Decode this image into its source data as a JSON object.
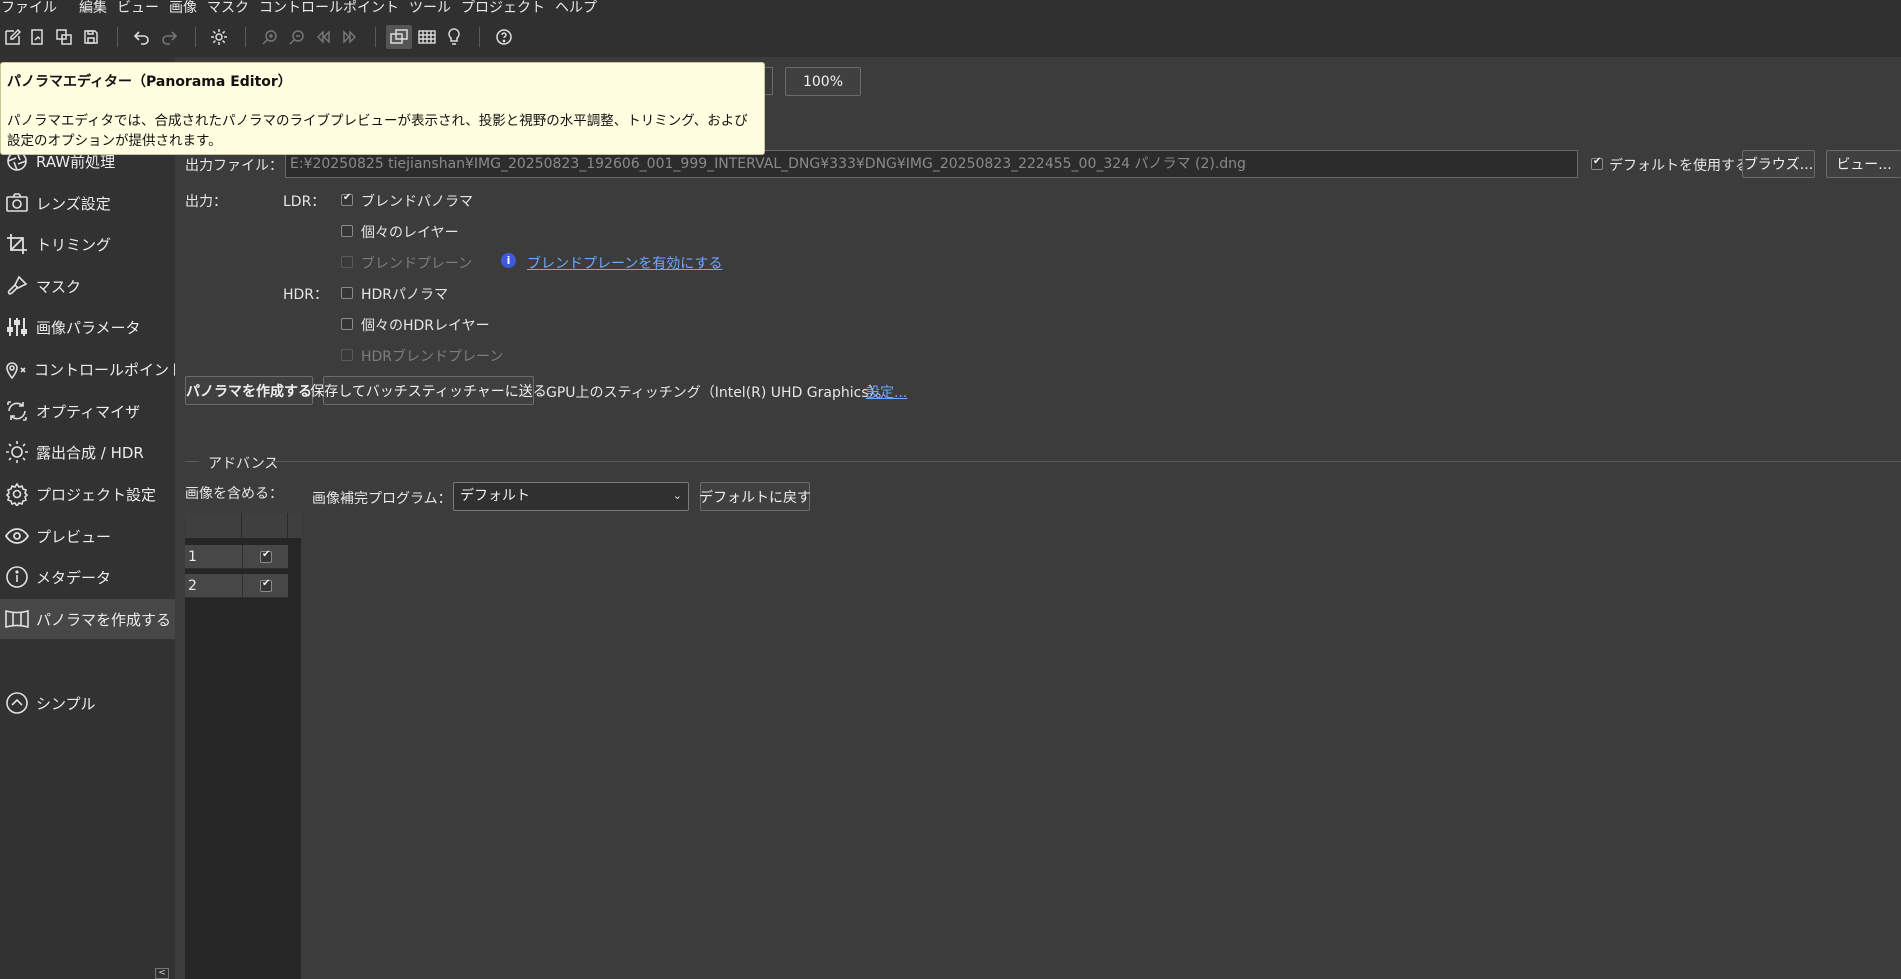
{
  "menu": [
    "ファイル",
    "編集",
    "ビュー",
    "画像",
    "マスク",
    "コントロールポイント",
    "ツール",
    "プロジェクト",
    "ヘルプ"
  ],
  "toolbar": {
    "icons": [
      "new-project-icon",
      "open-icon",
      "copy-icon",
      "save-icon",
      "undo-icon",
      "redo-icon",
      "settings-icon",
      "zoom-in-icon",
      "zoom-out-icon",
      "rewind-icon",
      "fast-forward-icon",
      "panorama-editor-icon",
      "grid-icon",
      "bulb-icon",
      "help-icon"
    ]
  },
  "tooltip": {
    "title": "パノラマエディター（Panorama Editor）",
    "body": "パノラマエディタでは、合成されたパノラマのライブプレビューが表示され、投影と視野の水平調整、トリミング、および設定のオプションが提供されます。"
  },
  "sidebar": {
    "items": [
      {
        "label": "RAW前処理",
        "icon": "aperture-icon"
      },
      {
        "label": "レンズ設定",
        "icon": "camera-icon"
      },
      {
        "label": "トリミング",
        "icon": "crop-icon"
      },
      {
        "label": "マスク",
        "icon": "brush-icon"
      },
      {
        "label": "画像パラメータ",
        "icon": "sliders-icon"
      },
      {
        "label": "コントロールポイント",
        "icon": "map-pin-icon"
      },
      {
        "label": "オプティマイザ",
        "icon": "optimize-icon"
      },
      {
        "label": "露出合成 / HDR",
        "icon": "sun-icon"
      },
      {
        "label": "プロジェクト設定",
        "icon": "gear-icon"
      },
      {
        "label": "プレビュー",
        "icon": "eye-icon"
      },
      {
        "label": "メタデータ",
        "icon": "info-icon"
      },
      {
        "label": "パノラマを作成する",
        "icon": "panorama-icon"
      }
    ],
    "simple_label": "シンプル",
    "collapse": "<"
  },
  "zoom_button": "100%",
  "output": {
    "file_label": "出力ファイル：",
    "file_path": "E:¥20250825 tiejianshan¥IMG_20250823_192606_001_999_INTERVAL_DNG¥333¥DNG¥IMG_20250823_222455_00_324 パノラマ (2).dng",
    "use_default_label": "デフォルトを使用する",
    "use_default_checked": true,
    "browse_button": "ブラウズ...",
    "view_button": "ビュー...",
    "output_label": "出力：",
    "ldr_label": "LDR：",
    "hdr_label": "HDR：",
    "ldr_options": [
      {
        "label": "ブレンドパノラマ",
        "checked": true,
        "disabled": false
      },
      {
        "label": "個々のレイヤー",
        "checked": false,
        "disabled": false
      },
      {
        "label": "ブレンドプレーン",
        "checked": false,
        "disabled": true
      }
    ],
    "enable_blend_link": "ブレンドプレーンを有効にする",
    "hdr_options": [
      {
        "label": "HDRパノラマ",
        "checked": false,
        "disabled": false
      },
      {
        "label": "個々のHDRレイヤー",
        "checked": false,
        "disabled": false
      },
      {
        "label": "HDRブレンドプレーン",
        "checked": false,
        "disabled": true
      }
    ],
    "create_button": "パノラマを作成する",
    "batch_button": "保存してバッチスティッチャーに送る",
    "gpu_text": "GPU上のスティッチング（Intel(R) UHD Graphics）。",
    "settings_link": "設定..."
  },
  "advanced": {
    "title": "アドバンス",
    "include_images_label": "画像を含める：",
    "interpolator_label": "画像補完プログラム：",
    "interpolator_value": "デフォルト",
    "reset_button": "デフォルトに戻す",
    "images": [
      {
        "id": "1",
        "included": true
      },
      {
        "id": "2",
        "included": true
      }
    ]
  }
}
